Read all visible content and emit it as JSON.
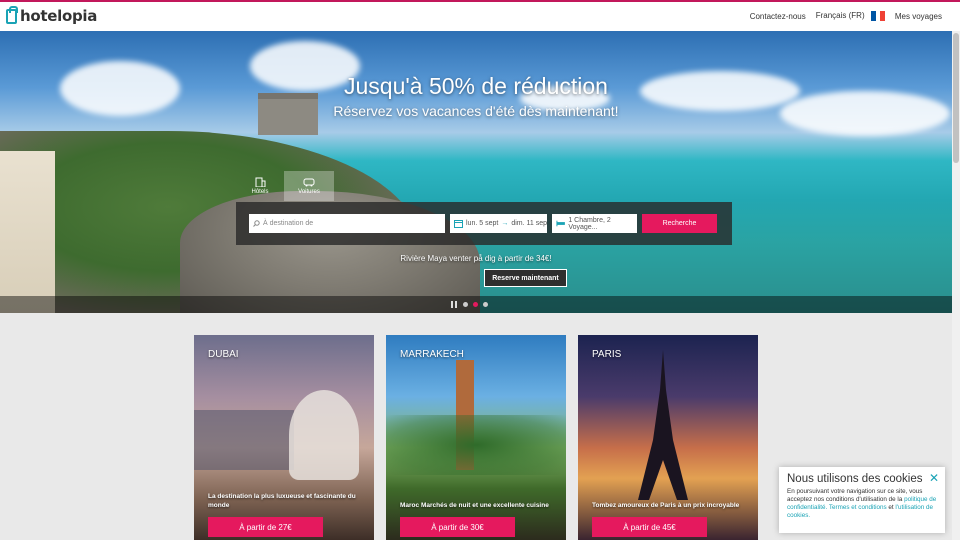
{
  "brand": {
    "name": "hotelopia",
    "accent": "#e5195e",
    "teal": "#1aa3b5"
  },
  "header": {
    "links": [
      "Contactez-nous",
      "Français (FR)",
      "Mes voyages"
    ],
    "flag_colors": [
      "#0055a4",
      "#ffffff",
      "#ef4135"
    ]
  },
  "hero": {
    "title": "Jusqu'à 50% de réduction",
    "subtitle": "Réservez vos vacances d'été dès maintenant!",
    "tabs": [
      {
        "label": "Hôtels",
        "icon": "hotel-icon"
      },
      {
        "label": "Voitures",
        "icon": "car-icon"
      }
    ],
    "search": {
      "destination_placeholder": "À destination de",
      "checkin": "lun. 5 sept",
      "checkout": "dim. 11 sep",
      "rooms": "1 Chambre, 2 Voyage...",
      "button": "Recherche"
    },
    "promo": "Rivière Maya venter på dig à partir de 34€!",
    "reserve_button": "Reserve maintenant",
    "carousel_dots": 3,
    "active_dot": 2
  },
  "cards": [
    {
      "city": "DUBAI",
      "desc": "La destination la plus luxueuse et fascinante du monde",
      "button": "À partir de 27€"
    },
    {
      "city": "MARRAKECH",
      "desc": "Maroc Marchés de nuit et une excellente cuisine",
      "button": "À partir de 30€"
    },
    {
      "city": "PARIS",
      "desc": "Tombez amoureux de Paris à un prix incroyable",
      "button": "À partir de 45€"
    }
  ],
  "cookie": {
    "title": "Nous utilisons des cookies",
    "text_before": "En poursuivant votre navigation sur ce site, vous acceptez nos conditions d'utilisation de la",
    "link1": "politique de confidentialité.",
    "link2": "Termes et conditions",
    "text_mid": "et",
    "link3": "l'utilisation de cookies.",
    "close": "✕"
  }
}
